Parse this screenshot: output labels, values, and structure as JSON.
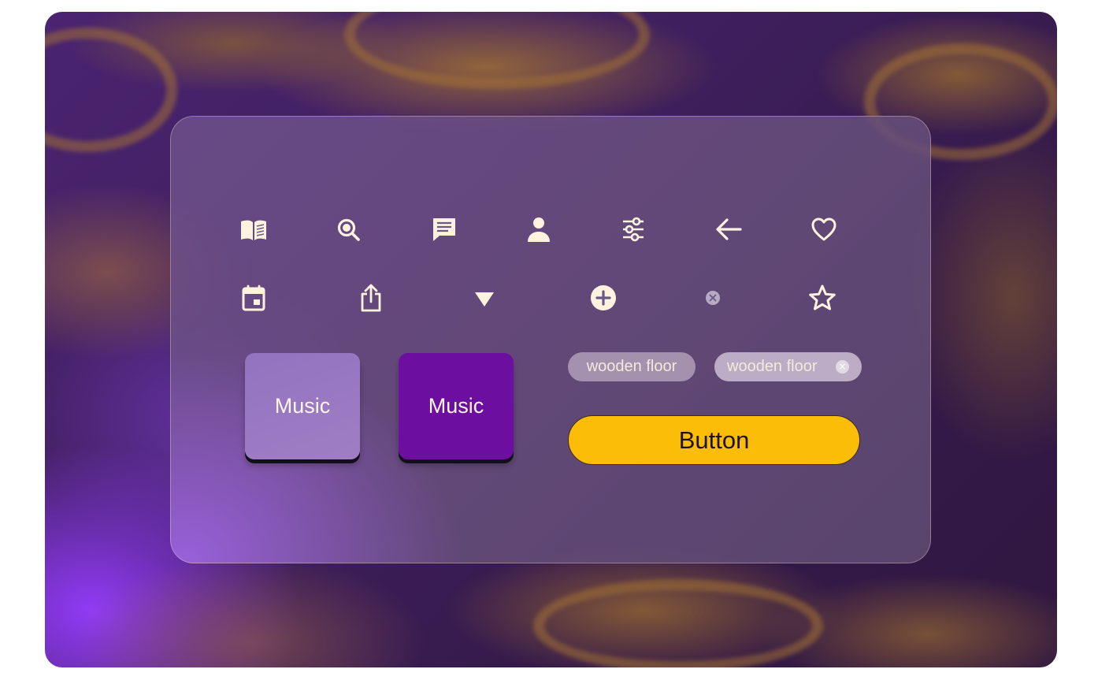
{
  "colors": {
    "icon": "#fff3e0",
    "accent_button": "#fbbd08",
    "tile_light": "#9a7ac2",
    "tile_dark": "#6c0ea0"
  },
  "icons": {
    "row1": [
      "book-open-icon",
      "search-icon",
      "comment-icon",
      "user-icon",
      "sliders-icon",
      "arrow-left-icon",
      "heart-icon"
    ],
    "row2": [
      "calendar-icon",
      "share-icon",
      "caret-down-icon",
      "add-circle-icon",
      "close-circle-icon",
      "star-icon"
    ]
  },
  "tiles": {
    "light_label": "Music",
    "dark_label": "Music"
  },
  "chips": {
    "chip1_label": "wooden floor",
    "chip2_label": "wooden floor",
    "chip2_close": "×"
  },
  "button": {
    "label": "Button"
  }
}
